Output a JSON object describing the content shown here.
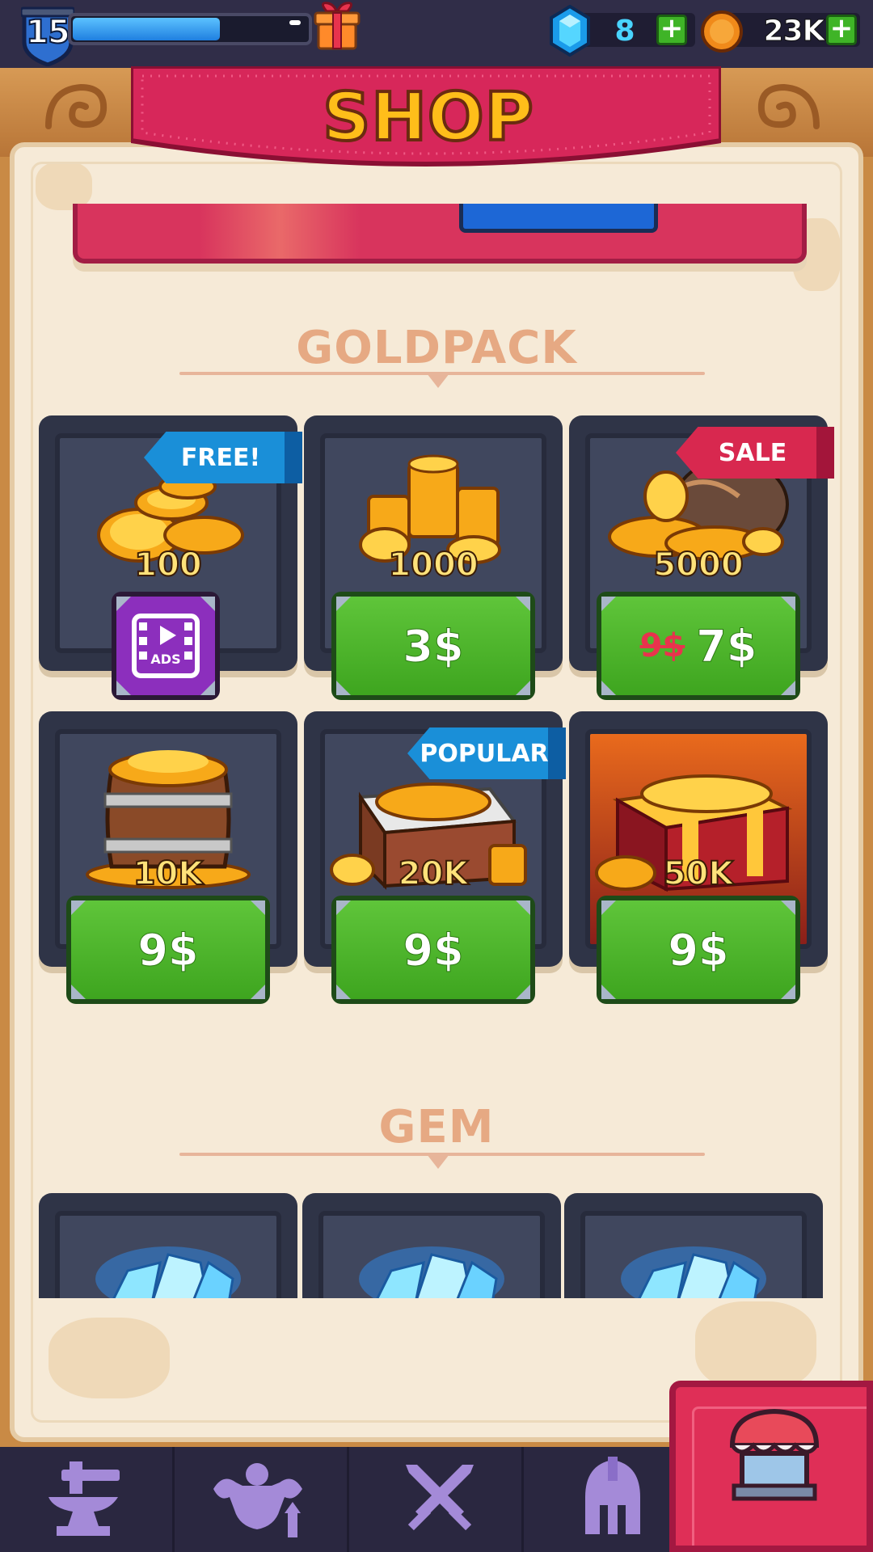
{
  "hud": {
    "level": "15",
    "xp_progress": 0.62,
    "gems": "8",
    "gold": "23K",
    "plus": "+"
  },
  "header": {
    "title": "SHOP"
  },
  "sections": {
    "goldpack": "GOLDPACK",
    "gem": "GEM"
  },
  "goldpacks": [
    {
      "amount": "100",
      "action": "ads",
      "ads_label": "ADS",
      "ribbon": "FREE!"
    },
    {
      "amount": "1000",
      "price": "3$"
    },
    {
      "amount": "5000",
      "price": "7$",
      "old_price": "9$",
      "ribbon": "SALE"
    },
    {
      "amount": "10K",
      "price": "9$"
    },
    {
      "amount": "20K",
      "price": "9$",
      "ribbon": "POPULAR"
    },
    {
      "amount": "50K",
      "price": "9$"
    }
  ],
  "nav": {
    "items": [
      "forge-icon",
      "strength-icon",
      "battle-icon",
      "heroes-icon",
      "shop-icon"
    ],
    "active": "shop"
  },
  "colors": {
    "accent_red": "#df2f57",
    "button_green": "#4fb82c",
    "gold_text": "#ffbe1a",
    "panel_bg": "#f6ead7"
  }
}
